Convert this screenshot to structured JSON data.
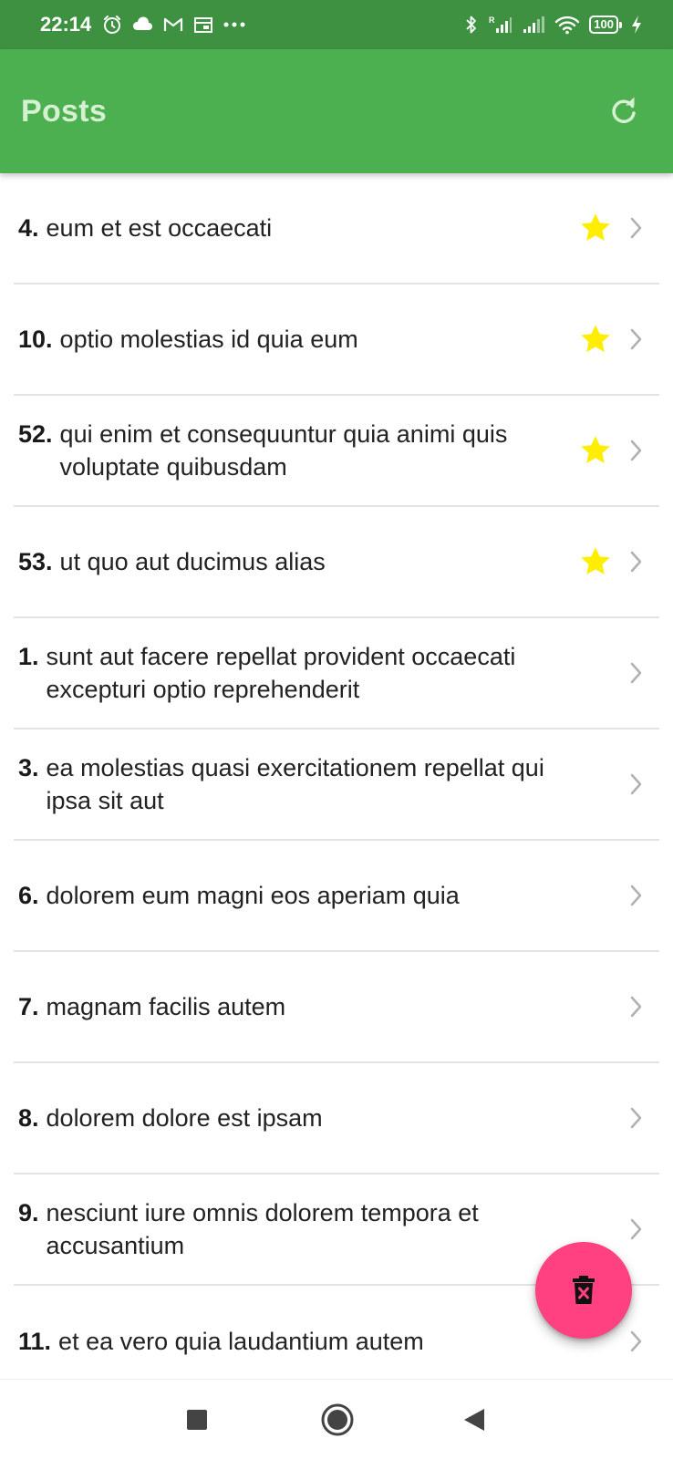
{
  "status_bar": {
    "time": "22:14",
    "battery": "100",
    "left_icons": [
      "alarm-icon",
      "cloud-icon",
      "gmail-icon",
      "calendar-icon",
      "more-notifications-icon"
    ],
    "right_icons": [
      "bluetooth-icon",
      "signal-roaming-icon",
      "signal-icon",
      "wifi-icon",
      "battery-icon",
      "charging-icon"
    ]
  },
  "app_bar": {
    "title": "Posts",
    "refresh_icon": "refresh-icon",
    "background_color": "#4caf50",
    "title_color": "#d6f0d2"
  },
  "posts": [
    {
      "id": "4.",
      "title": "eum et est occaecati",
      "favorite": true
    },
    {
      "id": "10.",
      "title": "optio molestias id quia eum",
      "favorite": true
    },
    {
      "id": "52.",
      "title": "qui enim et consequuntur quia animi quis voluptate quibusdam",
      "favorite": true
    },
    {
      "id": "53.",
      "title": "ut quo aut ducimus alias",
      "favorite": true
    },
    {
      "id": "1.",
      "title": "sunt aut facere repellat provident occaecati excepturi optio reprehenderit",
      "favorite": false
    },
    {
      "id": "3.",
      "title": "ea molestias quasi exercitationem repellat qui ipsa sit aut",
      "favorite": false
    },
    {
      "id": "6.",
      "title": "dolorem eum magni eos aperiam quia",
      "favorite": false
    },
    {
      "id": "7.",
      "title": "magnam facilis autem",
      "favorite": false
    },
    {
      "id": "8.",
      "title": "dolorem dolore est ipsam",
      "favorite": false
    },
    {
      "id": "9.",
      "title": "nesciunt iure omnis dolorem tempora et accusantium",
      "favorite": false
    },
    {
      "id": "11.",
      "title": "et ea vero quia laudantium autem",
      "favorite": false
    }
  ],
  "fab": {
    "icon": "delete-icon",
    "color": "#ff4081"
  },
  "nav_bar": {
    "icons": [
      "recents-icon",
      "home-icon",
      "back-icon"
    ]
  },
  "colors": {
    "star": "#ffee00",
    "chevron": "#b0b0b0",
    "status_bar": "#3e9141"
  }
}
